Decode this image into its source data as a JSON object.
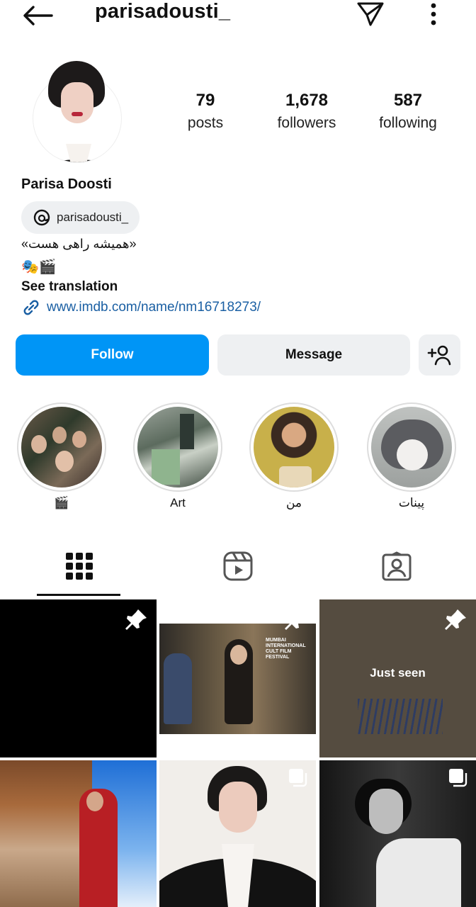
{
  "header": {
    "username": "parisadousti_",
    "back_icon": "arrow-left-icon",
    "send_icon": "paper-plane-icon",
    "more_icon": "vertical-dots-icon"
  },
  "profile": {
    "full_name": "Parisa Doosti",
    "stats": [
      {
        "value": "79",
        "label": "posts"
      },
      {
        "value": "1,678",
        "label": "followers"
      },
      {
        "value": "587",
        "label": "following"
      }
    ],
    "threads_handle": "parisadousti_",
    "bio_line1": "«همیشه راهی هست»",
    "bio_line2": "🎭🎬",
    "see_translation": "See translation",
    "link": "www.imdb.com/name/nm16718273/"
  },
  "actions": {
    "follow": "Follow",
    "message": "Message"
  },
  "highlights": [
    {
      "label": "🎬"
    },
    {
      "label": "Art"
    },
    {
      "label": "من"
    },
    {
      "label": "پینات"
    }
  ],
  "tabs": [
    "grid-icon",
    "reels-icon",
    "tagged-icon"
  ],
  "posts": [
    {
      "overlay": ""
    },
    {
      "overlay": "MUMBAI INTERNATIONAL CULT FILM FESTIVAL"
    },
    {
      "overlay": "Just seen"
    },
    {
      "overlay": ""
    },
    {
      "overlay": ""
    },
    {
      "overlay": ""
    }
  ],
  "colors": {
    "follow_blue": "#0095f6",
    "button_gray": "#eef0f2",
    "link_blue": "#1a5fa3"
  }
}
